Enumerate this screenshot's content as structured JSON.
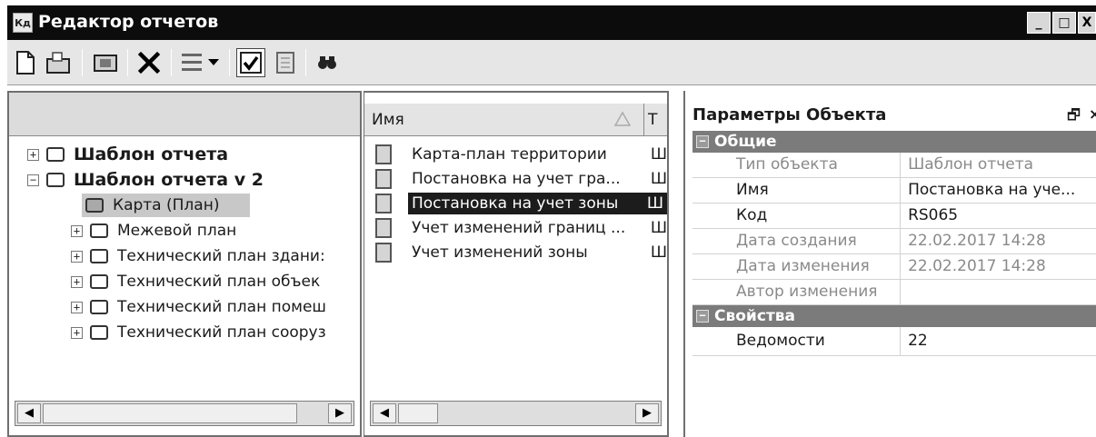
{
  "window": {
    "app_icon_text": "Кд",
    "title": "Редактор отчетов",
    "controls": [
      "_",
      "□",
      "X"
    ]
  },
  "toolbar": {
    "icons": [
      "new-document-icon",
      "open-folder-icon",
      "folder-image-icon",
      "delete-icon",
      "list-view-icon",
      "checkbox-icon",
      "document-icon",
      "binoculars-icon"
    ]
  },
  "tree": {
    "items": [
      {
        "label": "Шаблон отчета",
        "expander": "+"
      },
      {
        "label": "Шаблон отчета v 2",
        "expander": "−"
      },
      {
        "label": "Карта (План)"
      },
      {
        "label": "Межевой план",
        "expander": "+"
      },
      {
        "label": "Технический план здани:",
        "expander": "+"
      },
      {
        "label": "Технический план объек",
        "expander": "+"
      },
      {
        "label": "Технический план помеш",
        "expander": "+"
      },
      {
        "label": "Технический план сооруз",
        "expander": "+"
      }
    ]
  },
  "list": {
    "columns": [
      "Имя",
      "Т"
    ],
    "rows": [
      {
        "name": "Карта-план территории",
        "type": "Ш"
      },
      {
        "name": "Постановка на учет гра...",
        "type": "Ш"
      },
      {
        "name": "Постановка на учет зоны",
        "type": "Ш"
      },
      {
        "name": "Учет изменений границ ...",
        "type": "Ш"
      },
      {
        "name": "Учет изменений зоны",
        "type": "Ш"
      }
    ],
    "selected_index": 2
  },
  "properties": {
    "title": "Параметры Объекта",
    "pin": "🗗",
    "close": "×",
    "categories": [
      {
        "name": "Общие",
        "rows": [
          {
            "name": "Тип объекта",
            "value": "Шаблон отчета"
          },
          {
            "name": "Имя",
            "value": "Постановка на уче..."
          },
          {
            "name": "Код",
            "value": "RS065"
          },
          {
            "name": "Дата создания",
            "value": "22.02.2017 14:28"
          },
          {
            "name": "Дата изменения",
            "value": "22.02.2017 14:28"
          },
          {
            "name": "Автор изменения",
            "value": ""
          }
        ]
      },
      {
        "name": "Свойства",
        "rows": [
          {
            "name": "Ведомости",
            "value": "22"
          }
        ]
      }
    ]
  }
}
